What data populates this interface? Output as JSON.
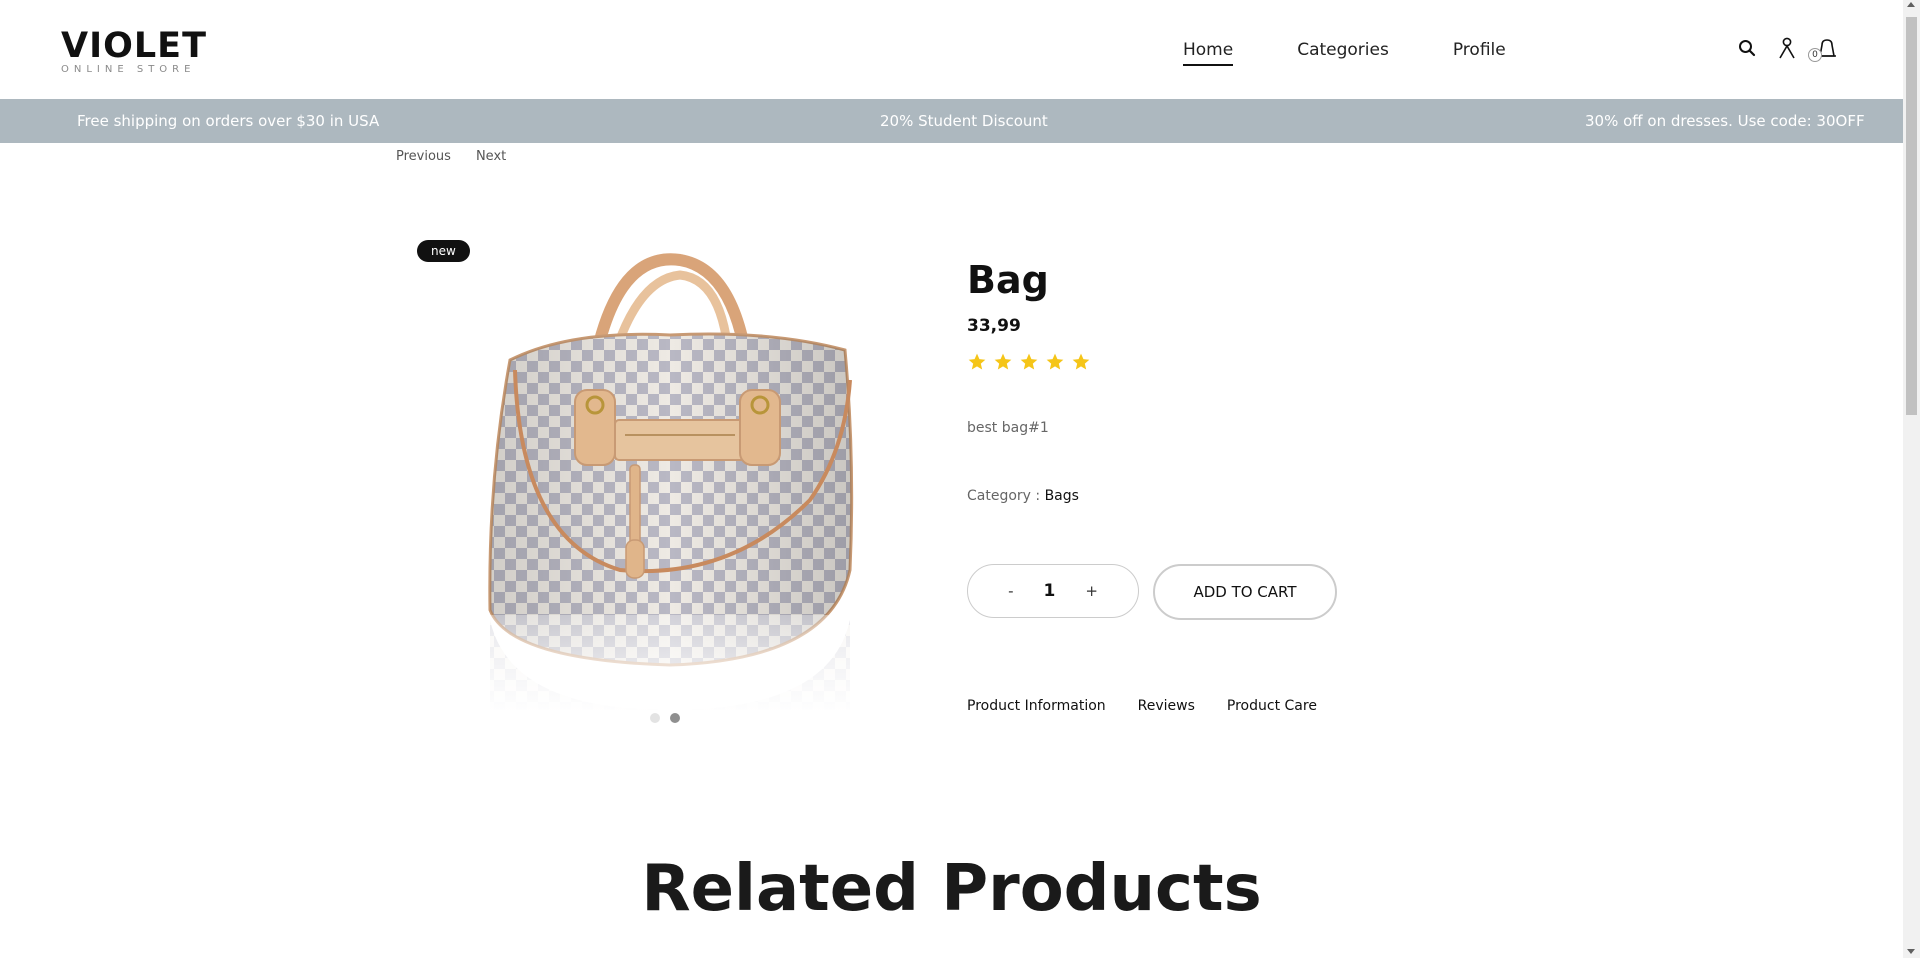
{
  "brand": {
    "name": "VIOLET",
    "tagline": "ONLINE STORE"
  },
  "nav": {
    "items": [
      {
        "label": "Home",
        "active": true
      },
      {
        "label": "Categories",
        "active": false
      },
      {
        "label": "Profile",
        "active": false
      }
    ]
  },
  "header_icons": {
    "search": "search-icon",
    "user": "user-icon",
    "cart": "bag-icon",
    "cart_count": "0"
  },
  "promo": {
    "left": "Free shipping on orders over $30 in USA",
    "center": "20% Student Discount",
    "right": "30% off on dresses. Use code: 30OFF",
    "background": "#adb8bf"
  },
  "pager": {
    "previous": "Previous",
    "next": "Next"
  },
  "product": {
    "badge": "new",
    "title": "Bag",
    "price": "33,99",
    "rating": 5,
    "rating_max": 5,
    "description": "best bag#1",
    "category_label": "Category :",
    "category_value": "Bags",
    "quantity": "1",
    "qty_minus": "-",
    "qty_plus": "+",
    "add_to_cart": "ADD TO CART",
    "star_color": "#f5c518",
    "image_slides": 2,
    "active_slide": 2
  },
  "tabs": [
    "Product Information",
    "Reviews",
    "Product Care"
  ],
  "related": {
    "heading": "Related Products"
  }
}
